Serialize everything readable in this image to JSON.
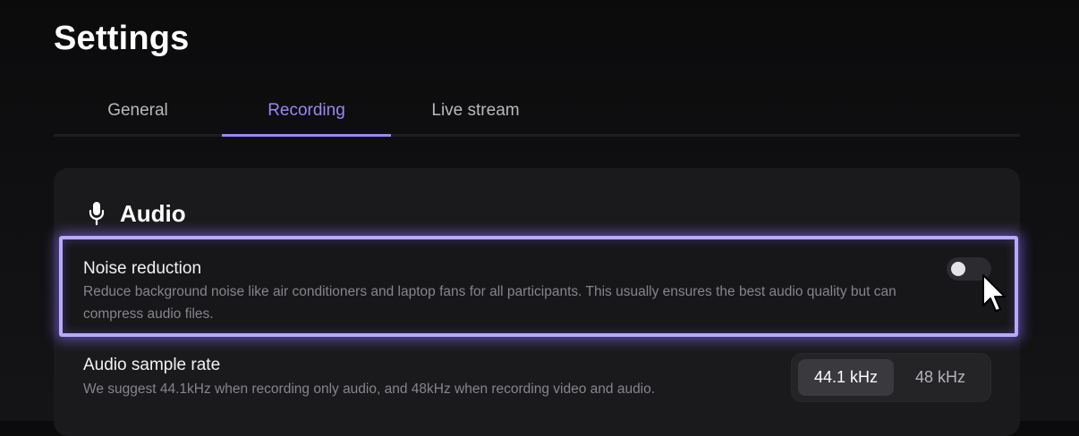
{
  "page": {
    "title": "Settings"
  },
  "tabs": [
    {
      "label": "General",
      "active": false
    },
    {
      "label": "Recording",
      "active": true
    },
    {
      "label": "Live stream",
      "active": false
    }
  ],
  "audio_section": {
    "title": "Audio",
    "icon": "microphone-icon",
    "noise_reduction": {
      "label": "Noise reduction",
      "description": "Reduce background noise like air conditioners and laptop fans for all participants. This usually ensures the best audio quality but can compress audio files.",
      "enabled": false
    },
    "sample_rate": {
      "label": "Audio sample rate",
      "description": "We suggest 44.1kHz when recording only audio, and 48kHz when recording video and audio.",
      "options": [
        "44.1 kHz",
        "48 kHz"
      ],
      "selected": "44.1 kHz"
    }
  },
  "colors": {
    "accent": "#9b87f5",
    "highlight_border": "#b9a9ff",
    "background": "#0e0e10",
    "card": "#1a1a1c"
  }
}
